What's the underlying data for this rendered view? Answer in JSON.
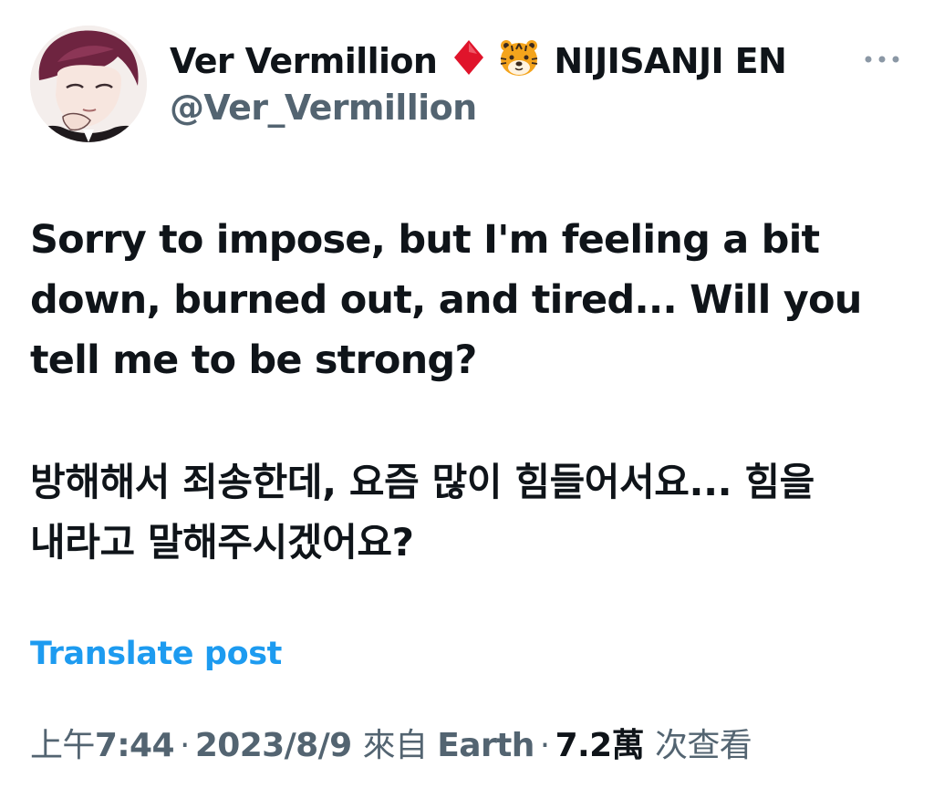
{
  "author": {
    "display_name_part1": "Ver Vermillion",
    "display_name_part2": "NIJISANJI EN",
    "handle": "@Ver_Vermillion",
    "avatar_icon": "avatar-portrait",
    "diamond_icon": "red-diamond-icon",
    "diamond_color": "#e0142b",
    "tiger_icon": "tiger-face-icon"
  },
  "more_icon": "more-options-icon",
  "post": {
    "text_en_lines": [
      "Sorry to impose, but I'm feeling a bit",
      "down, burned out, and tired... Will you",
      "tell me to be strong?"
    ],
    "text_ko_lines": [
      "방해해서 죄송한데, 요즘 많이 힘들어서요... 힘을",
      "내라고 말해주시겠어요?"
    ],
    "translate_label": "Translate post"
  },
  "meta": {
    "time_prefix": "上午",
    "time": "7:44",
    "separator": "·",
    "date": "2023/8/9",
    "source_prefix": "來自",
    "source": "Earth",
    "views": "7.2萬",
    "views_label": "次查看"
  },
  "colors": {
    "text_primary": "#0f1419",
    "text_secondary": "#536471",
    "link": "#1d9bf0"
  }
}
